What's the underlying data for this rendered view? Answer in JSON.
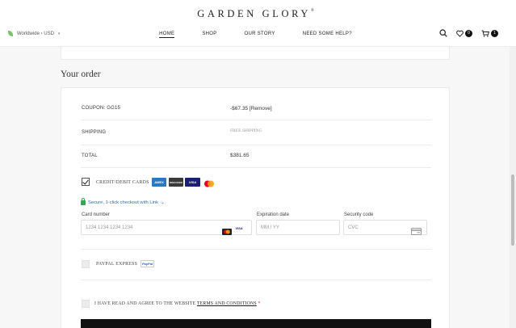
{
  "header": {
    "brand": "GARDEN GLORY",
    "brand_mark": "®",
    "locale": "Worldwide › USD",
    "nav": [
      "HOME",
      "SHOP",
      "OUR STORY",
      "NEED SOME HELP?"
    ],
    "wishlist_count": "0",
    "cart_count": "1"
  },
  "order": {
    "heading": "Your order",
    "coupon_label": "COUPON: GG15",
    "coupon_value": "-$67.35 [Remove]",
    "shipping_label": "SHIPPING",
    "shipping_value": "FREE SHIPPING",
    "total_label": "TOTAL",
    "total_value": "$381.65"
  },
  "payment": {
    "card_option_label": "CREDIT/DEBIT CARDS",
    "card_brands": [
      "AMEX",
      "DISCOVER",
      "VISA",
      "mastercard"
    ],
    "secure_link": "Secure, 1-click checkout with Link",
    "card_number_label": "Card number",
    "card_number_placeholder": "1234 1234 1234 1234",
    "expiry_label": "Expiration date",
    "expiry_placeholder": "MM / YY",
    "cvc_label": "Security code",
    "cvc_placeholder": "CVC",
    "paypal_label": "PAYPAL EXPRESS",
    "paypal_badge": "PayPal"
  },
  "terms": {
    "prefix": "I HAVE READ AND AGREE TO THE WEBSITE",
    "link": "TERMS AND CONDITIONS",
    "required_mark": "*"
  },
  "colors": {
    "accent_link": "#2a6fbf",
    "lock_green": "#3aa655",
    "required_red": "#c0392b"
  }
}
